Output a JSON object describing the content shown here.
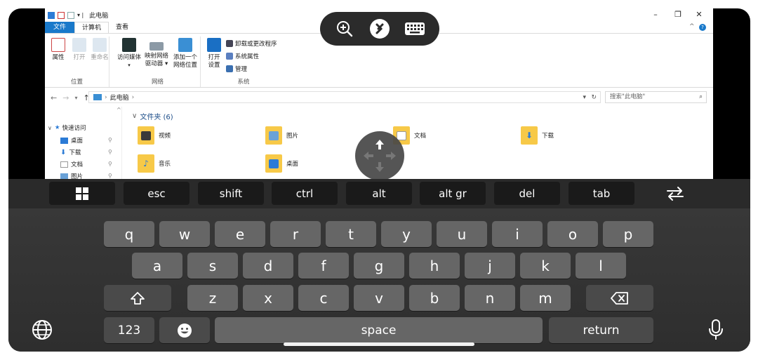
{
  "explorer": {
    "window_title": "此电脑",
    "controls": {
      "minimize": "–",
      "maximize": "❐",
      "close": "✕"
    },
    "tabs": [
      "文件",
      "计算机",
      "查看"
    ],
    "ribbon": {
      "group_location": {
        "label": "位置",
        "buttons": [
          "属性",
          "打开",
          "重命名"
        ]
      },
      "group_network": {
        "label": "网络",
        "btn_media": [
          "访问媒体",
          ""
        ],
        "btn_map": [
          "映射网络",
          "驱动器 ▾"
        ],
        "btn_add": [
          "添加一个",
          "网络位置"
        ]
      },
      "group_system": {
        "label": "系统",
        "btn_settings": [
          "打开",
          "设置"
        ],
        "small": [
          "卸载或更改程序",
          "系统属性",
          "管理"
        ]
      }
    },
    "address": {
      "path": "此电脑",
      "separator": "›"
    },
    "search_placeholder": "搜索\"此电脑\"",
    "nav": {
      "quick_access": "快速访问",
      "items": [
        "桌面",
        "下载",
        "文档",
        "图片"
      ]
    },
    "content": {
      "group_title": "文件夹 (6)",
      "folders": [
        "视频",
        "图片",
        "文档",
        "下载",
        "音乐",
        "桌面"
      ]
    }
  },
  "keyboard": {
    "modifiers": [
      "esc",
      "shift",
      "ctrl",
      "alt",
      "alt gr",
      "del",
      "tab"
    ],
    "row1": [
      "q",
      "w",
      "e",
      "r",
      "t",
      "y",
      "u",
      "i",
      "o",
      "p"
    ],
    "row2": [
      "a",
      "s",
      "d",
      "f",
      "g",
      "h",
      "j",
      "k",
      "l"
    ],
    "row3": [
      "z",
      "x",
      "c",
      "v",
      "b",
      "n",
      "m"
    ],
    "bottom": {
      "numbers": "123",
      "space": "space",
      "return": "return"
    }
  },
  "icons": {
    "toolbar": [
      "zoom-in-icon",
      "remote-desktop-logo-icon",
      "keyboard-icon"
    ],
    "keyboard": [
      "windows-key-icon",
      "swap-arrows-icon",
      "shift-arrow-icon",
      "backspace-icon",
      "emoji-icon",
      "globe-icon",
      "microphone-icon"
    ]
  },
  "colors": {
    "file_tab": "#1979ca",
    "key": "#666666",
    "modifier_key": "#1a1a1a",
    "keyboard_bg": "#333333"
  }
}
